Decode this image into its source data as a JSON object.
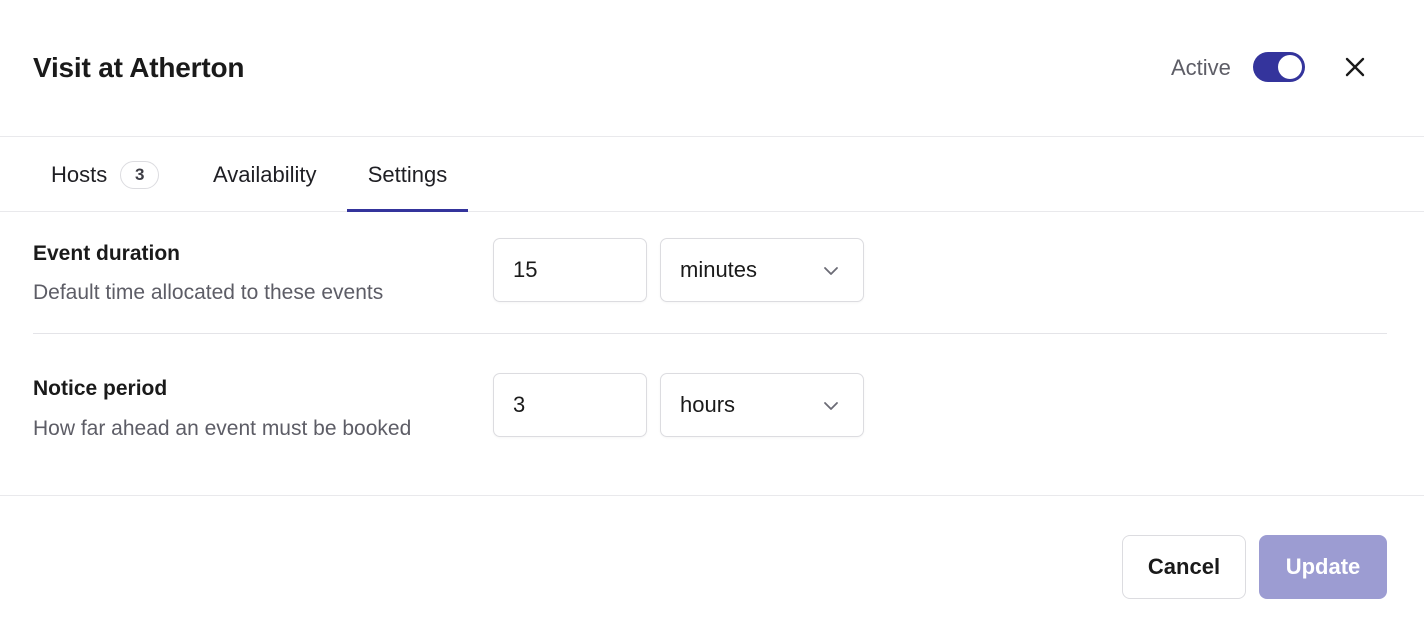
{
  "header": {
    "title": "Visit at Atherton",
    "active_label": "Active",
    "active": true
  },
  "tabs": [
    {
      "label": "Hosts",
      "badge": "3",
      "selected": false
    },
    {
      "label": "Availability",
      "selected": false
    },
    {
      "label": "Settings",
      "selected": true
    }
  ],
  "settings": {
    "event_duration": {
      "label": "Event duration",
      "description": "Default time allocated to these events",
      "value": "15",
      "unit": "minutes"
    },
    "notice_period": {
      "label": "Notice period",
      "description": "How far ahead an event must be booked",
      "value": "3",
      "unit": "hours"
    }
  },
  "footer": {
    "cancel_label": "Cancel",
    "update_label": "Update"
  },
  "colors": {
    "accent": "#34349c",
    "accent_disabled": "#9c9cd2",
    "muted_text": "#5d5d66"
  },
  "icons": {
    "close": "close-icon",
    "select_arrow": "chevron-down-icon"
  }
}
